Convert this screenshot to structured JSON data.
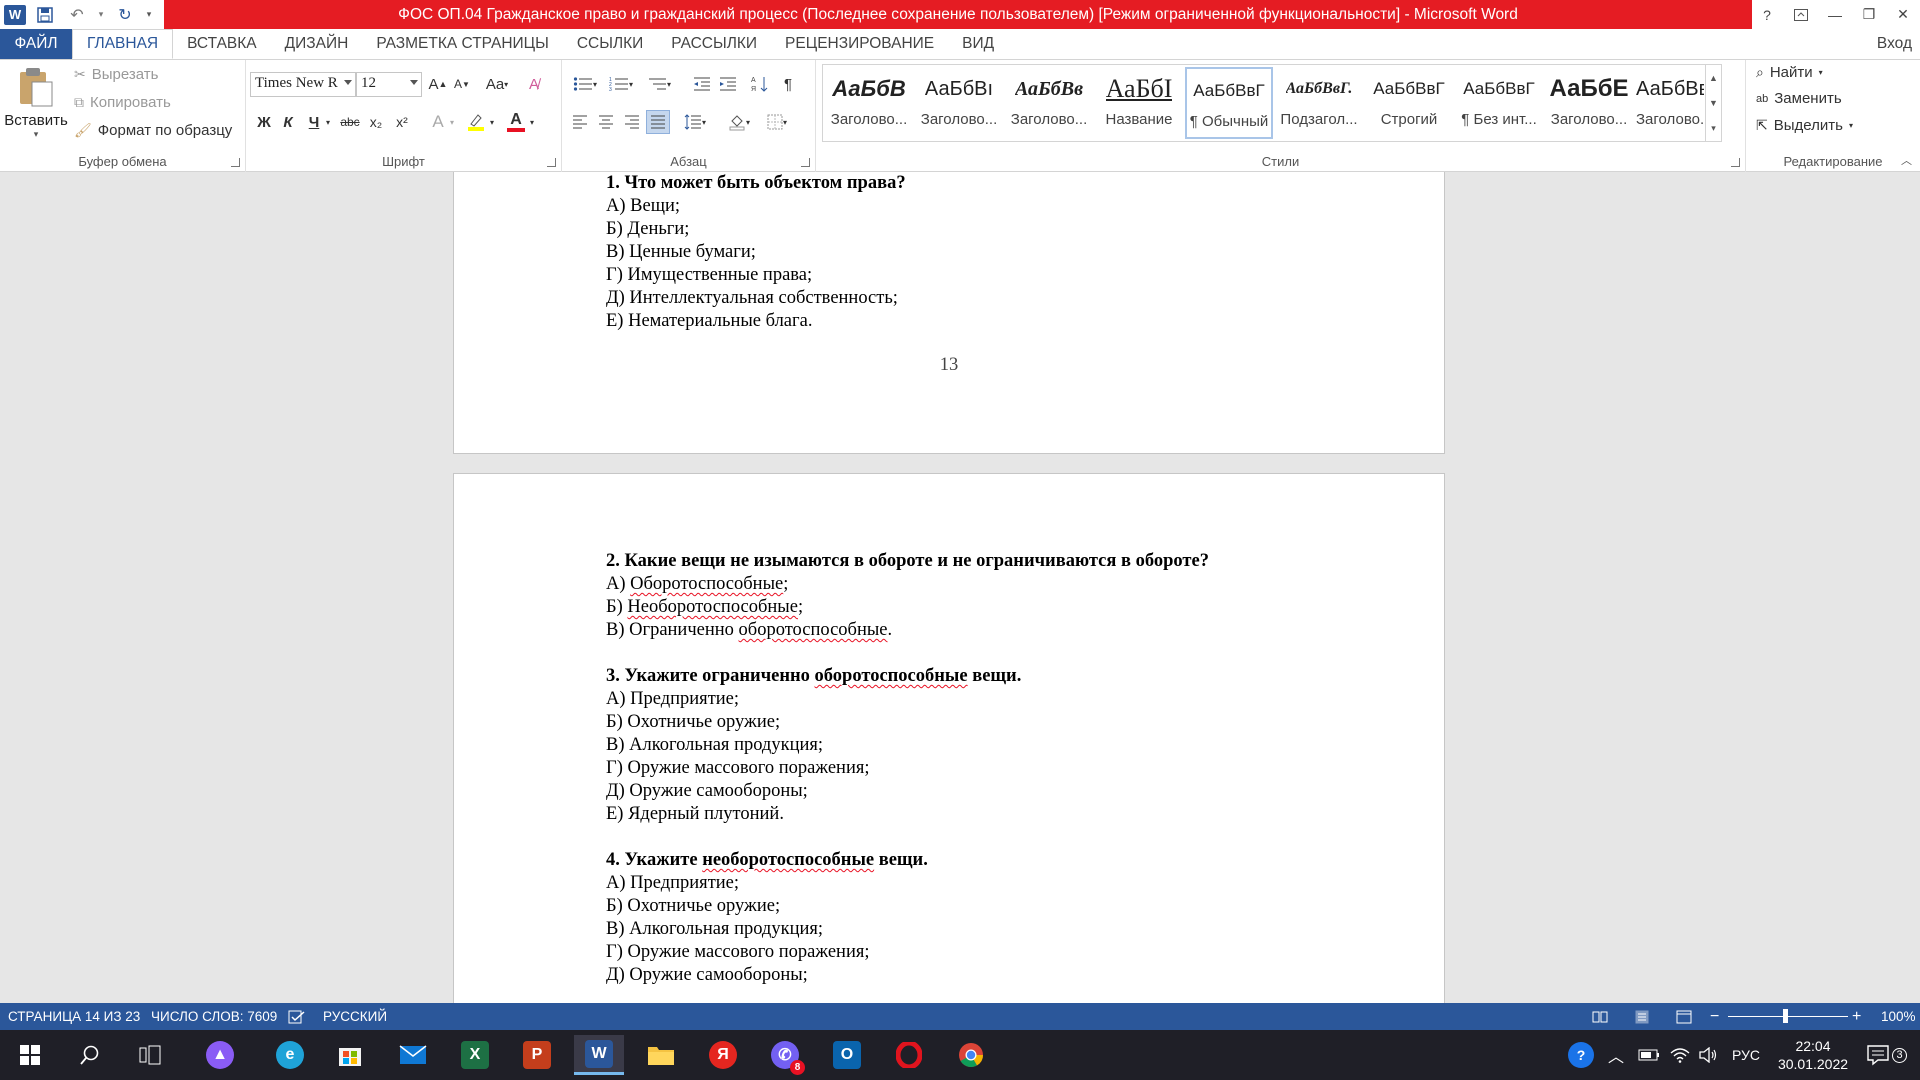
{
  "titlebar": {
    "title": "ФОС ОП.04 Гражданское право и гражданский процесс (Последнее сохранение пользователем) [Режим ограниченной функциональности] -  Microsoft Word",
    "app_icon": "W",
    "help": "?"
  },
  "tabs": {
    "file": "ФАЙЛ",
    "items": [
      "ГЛАВНАЯ",
      "ВСТАВКА",
      "ДИЗАЙН",
      "РАЗМЕТКА СТРАНИЦЫ",
      "ССЫЛКИ",
      "РАССЫЛКИ",
      "РЕЦЕНЗИРОВАНИЕ",
      "ВИД"
    ],
    "signin": "Вход"
  },
  "ribbon": {
    "clipboard": {
      "label": "Буфер обмена",
      "paste": "Вставить",
      "cut": "Вырезать",
      "copy": "Копировать",
      "format_painter": "Формат по образцу"
    },
    "font": {
      "label": "Шрифт",
      "font_name": "Times New R",
      "font_size": "12",
      "bold": "Ж",
      "italic": "К",
      "underline": "Ч",
      "strike": "abc",
      "subscript": "x₂",
      "superscript": "x²",
      "case": "Aa"
    },
    "paragraph": {
      "label": "Абзац"
    },
    "styles": {
      "label": "Стили",
      "items": [
        {
          "preview": "АаБбВ",
          "name": "Заголово..."
        },
        {
          "preview": "АаБбВı",
          "name": "Заголово..."
        },
        {
          "preview": "АаБбВв",
          "name": "Заголово..."
        },
        {
          "preview": "АаБбI",
          "name": "Название"
        },
        {
          "preview": "АаБбВвГ",
          "name": "¶ Обычный"
        },
        {
          "preview": "АаБбВвГ.",
          "name": "Подзагол..."
        },
        {
          "preview": "АаБбВвГ",
          "name": "Строгий"
        },
        {
          "preview": "АаБбВвГ",
          "name": "¶ Без инт..."
        },
        {
          "preview": "АаБбЕ",
          "name": "Заголово..."
        },
        {
          "preview": "АаБбВв",
          "name": "Заголово..."
        }
      ]
    },
    "editing": {
      "label": "Редактирование",
      "find": "Найти",
      "replace": "Заменить",
      "select": "Выделить"
    }
  },
  "document": {
    "page1": {
      "lines": [
        "1. Что может быть объектом права?",
        "А) Вещи;",
        "Б) Деньги;",
        "В) Ценные бумаги;",
        "Г) Имущественные права;",
        "Д) Интеллектуальная собственность;",
        "Е) Нематериальные блага."
      ],
      "page_number": "13"
    },
    "page2": {
      "q2": {
        "title": "2. Какие вещи не изымаются в обороте и не ограничиваются в обороте?",
        "a_prefix": "А) ",
        "a_word": "Оборотоспособные",
        "a_suffix": ";",
        "b_prefix": "Б) ",
        "b_word": "Необоротоспособные",
        "b_suffix": ";",
        "c_prefix": "В) Ограниченно ",
        "c_word": "оборотоспособные",
        "c_suffix": "."
      },
      "q3": {
        "title_prefix": "3. Укажите ограниченно ",
        "title_word": "оборотоспособные",
        "title_suffix": " вещи.",
        "options": [
          "А) Предприятие;",
          "Б) Охотничье оружие;",
          "В) Алкогольная продукция;",
          "Г) Оружие массового поражения;",
          "Д) Оружие самообороны;",
          "Е) Ядерный плутоний."
        ]
      },
      "q4": {
        "title_prefix": "4. Укажите ",
        "title_word": "необоротоспособные",
        "title_suffix": " вещи.",
        "options": [
          "А) Предприятие;",
          "Б) Охотничье оружие;",
          "В) Алкогольная продукция;",
          "Г) Оружие массового поражения;",
          "Д) Оружие самообороны;"
        ]
      }
    }
  },
  "statusbar": {
    "page": "СТРАНИЦА 14 ИЗ 23",
    "words": "ЧИСЛО СЛОВ: 7609",
    "language": "РУССКИЙ",
    "zoom": "100%"
  },
  "taskbar": {
    "lang": "РУС",
    "time": "22:04",
    "date": "30.01.2022",
    "notifications": "3",
    "viber_badge": "8"
  }
}
